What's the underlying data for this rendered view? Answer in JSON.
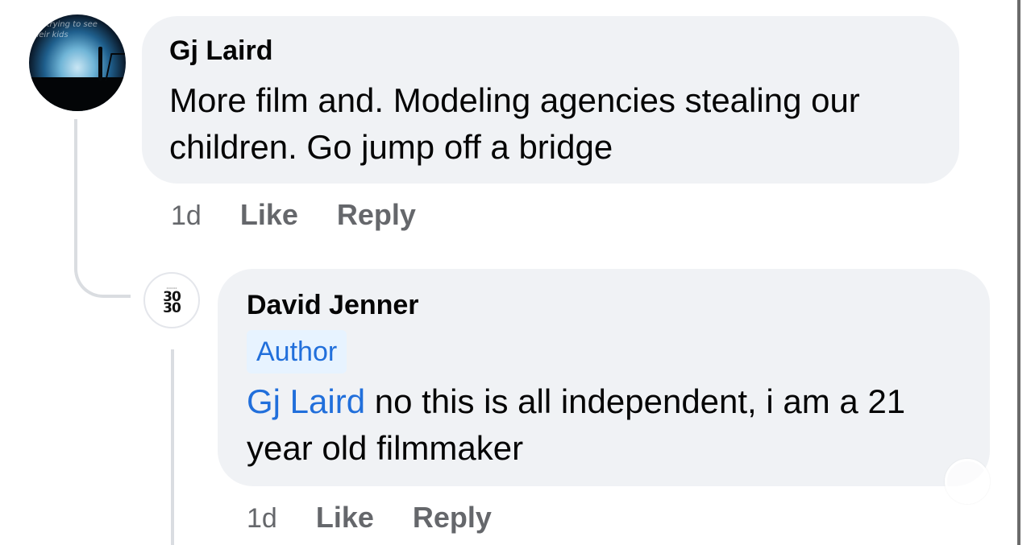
{
  "comments": [
    {
      "author": "Gj Laird",
      "avatar_icon": "profile-photo-icon",
      "avatar_text": "are trying to see their kids",
      "text": "More film and. Modeling agencies stealing our children.  Go jump off a bridge",
      "time": "1d",
      "like_label": "Like",
      "reply_label": "Reply"
    },
    {
      "author": "David Jenner",
      "avatar_icon": "3030-logo-icon",
      "avatar_logo_line1": "30",
      "avatar_logo_line2": "30",
      "badge": "Author",
      "mention": "Gj Laird",
      "text": " no this is all independent, i am a 21 year old filmmaker",
      "time": "1d",
      "like_label": "Like",
      "reply_label": "Reply"
    }
  ],
  "colors": {
    "bubble_bg": "#f0f2f5",
    "link_blue": "#216fdb",
    "meta_gray": "#65676b",
    "thread_line": "#dadde1"
  }
}
